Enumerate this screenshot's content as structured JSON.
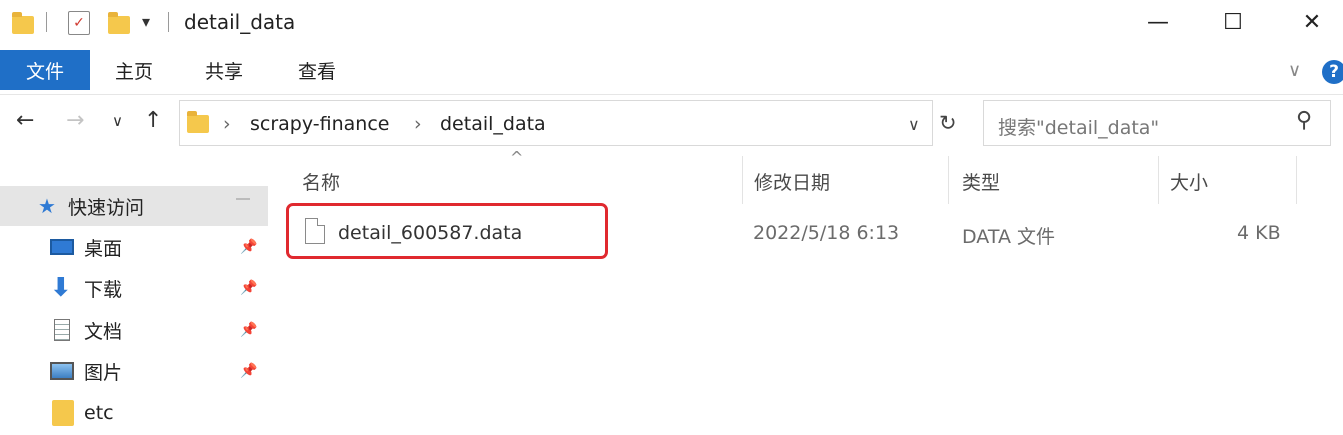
{
  "window": {
    "title": "detail_data",
    "minimize": "—",
    "maximize": "☐",
    "close": "✕"
  },
  "ribbon": {
    "tabs": [
      "文件",
      "主页",
      "共享",
      "查看"
    ],
    "expand": "∨",
    "help": "?"
  },
  "nav": {
    "back": "←",
    "forward": "→",
    "recent": "∨",
    "up": "↑",
    "breadcrumb": [
      "scrapy-finance",
      "detail_data"
    ],
    "separator": "›",
    "dropdown": "∨",
    "refresh": "↻",
    "search_placeholder": "搜索\"detail_data\"",
    "search_icon": "⚲"
  },
  "sidebar": {
    "items": [
      {
        "label": "快速访问",
        "icon": "star-icon"
      },
      {
        "label": "桌面",
        "icon": "desktop-icon"
      },
      {
        "label": "下载",
        "icon": "download-icon"
      },
      {
        "label": "文档",
        "icon": "document-icon"
      },
      {
        "label": "图片",
        "icon": "picture-icon"
      },
      {
        "label": "etc",
        "icon": "folder-icon"
      }
    ]
  },
  "list": {
    "sort_indicator": "^",
    "columns": [
      "名称",
      "修改日期",
      "类型",
      "大小"
    ],
    "rows": [
      {
        "name": "detail_600587.data",
        "modified": "2022/5/18 6:13",
        "type": "DATA 文件",
        "size": "4 KB"
      }
    ]
  },
  "colors": {
    "accent": "#1f6fc7",
    "highlight": "#e0292f"
  }
}
